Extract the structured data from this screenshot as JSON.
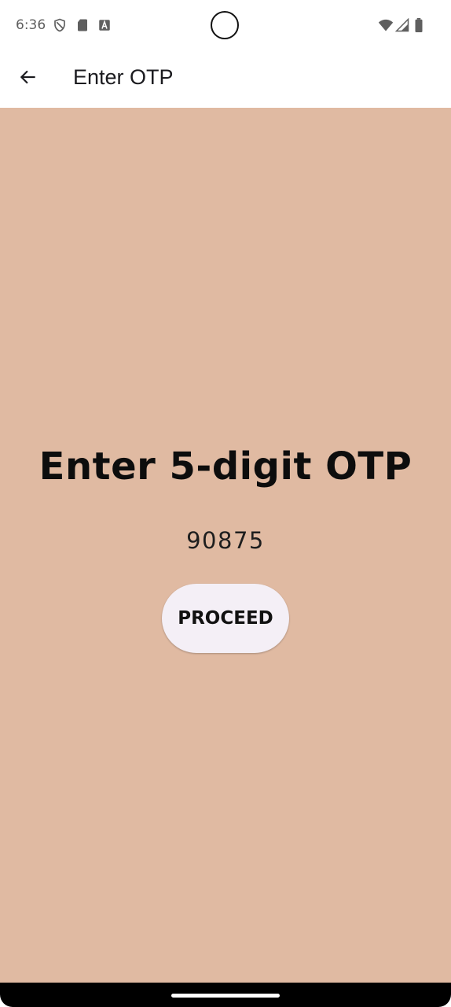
{
  "status_bar": {
    "time": "6:36",
    "left_icons": [
      "vpn-shield-icon",
      "sd-card-icon",
      "font-a-icon"
    ],
    "right_icons": [
      "wifi-icon",
      "signal-icon",
      "battery-icon"
    ]
  },
  "app_bar": {
    "back_icon": "arrow-back-icon",
    "title": "Enter OTP"
  },
  "main": {
    "heading": "Enter 5-digit OTP",
    "otp_value": "90875",
    "proceed_label": "PROCEED"
  },
  "colors": {
    "content_background": "#e0baa2",
    "button_background": "#f4eff6",
    "app_bar_background": "#ffffff"
  }
}
